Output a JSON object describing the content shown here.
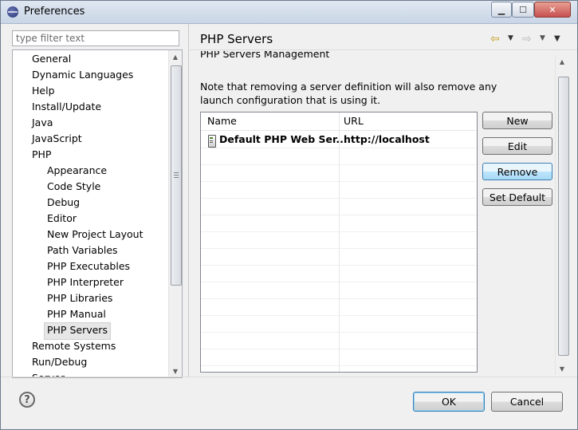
{
  "window": {
    "title": "Preferences"
  },
  "filter": {
    "placeholder": "type filter text"
  },
  "tree": {
    "items": [
      {
        "label": "General",
        "level": 0
      },
      {
        "label": "Dynamic Languages",
        "level": 0
      },
      {
        "label": "Help",
        "level": 0
      },
      {
        "label": "Install/Update",
        "level": 0
      },
      {
        "label": "Java",
        "level": 0
      },
      {
        "label": "JavaScript",
        "level": 0
      },
      {
        "label": "PHP",
        "level": 0
      },
      {
        "label": "Appearance",
        "level": 1
      },
      {
        "label": "Code Style",
        "level": 1
      },
      {
        "label": "Debug",
        "level": 1
      },
      {
        "label": "Editor",
        "level": 1
      },
      {
        "label": "New Project Layout",
        "level": 1
      },
      {
        "label": "Path Variables",
        "level": 1
      },
      {
        "label": "PHP Executables",
        "level": 1
      },
      {
        "label": "PHP Interpreter",
        "level": 1
      },
      {
        "label": "PHP Libraries",
        "level": 1
      },
      {
        "label": "PHP Manual",
        "level": 1
      },
      {
        "label": "PHP Servers",
        "level": 1,
        "selected": true
      },
      {
        "label": "Remote Systems",
        "level": 0
      },
      {
        "label": "Run/Debug",
        "level": 0
      },
      {
        "label": "Server",
        "level": 0
      }
    ]
  },
  "page": {
    "title": "PHP Servers",
    "section_title": "PHP Servers Management",
    "description": "Note that removing a server definition will also remove any launch configuration that is using it."
  },
  "table": {
    "columns": [
      "Name",
      "URL"
    ],
    "rows": [
      {
        "name": "Default PHP Web Ser...",
        "url": "http://localhost"
      }
    ]
  },
  "buttons": {
    "new": "New",
    "edit": "Edit",
    "remove": "Remove",
    "set_default": "Set Default"
  },
  "footer": {
    "help": "?",
    "ok": "OK",
    "cancel": "Cancel"
  },
  "icons": {
    "app": "eclipse-icon",
    "back": "back-arrow-icon",
    "forward": "forward-arrow-icon",
    "menu": "view-menu-icon",
    "server": "server-icon",
    "help": "help-icon"
  }
}
